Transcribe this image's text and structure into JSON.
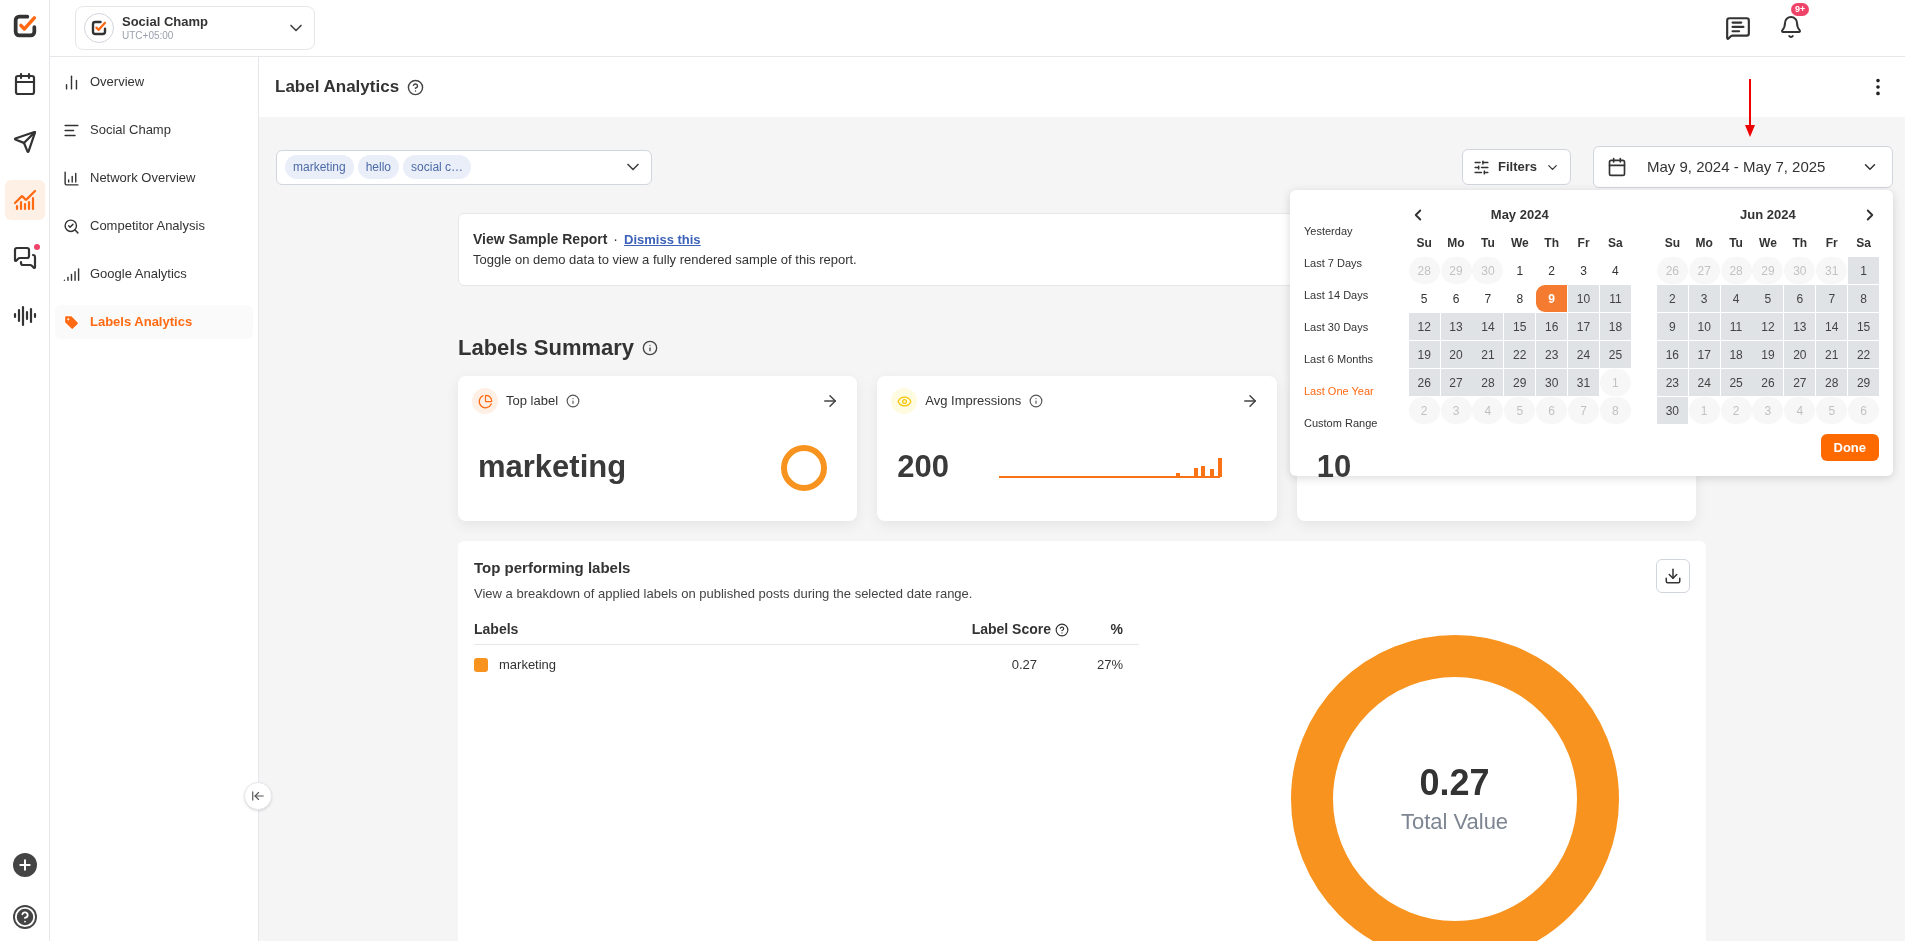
{
  "rail": {
    "items": [
      {
        "kind": "calendar",
        "selected": false,
        "dot": false
      },
      {
        "kind": "send",
        "selected": false,
        "dot": false
      },
      {
        "kind": "analytics",
        "selected": true,
        "dot": false
      },
      {
        "kind": "chat",
        "selected": false,
        "dot": true
      },
      {
        "kind": "audio",
        "selected": false,
        "dot": false
      }
    ]
  },
  "account": {
    "name": "Social Champ",
    "timezone": "UTC+05:00"
  },
  "notifications": {
    "badge": "9+"
  },
  "sidebar": {
    "items": [
      {
        "kind": "overview",
        "label": "Overview",
        "selected": false
      },
      {
        "kind": "social",
        "label": "Social Champ",
        "selected": false
      },
      {
        "kind": "network",
        "label": "Network Overview",
        "selected": false
      },
      {
        "kind": "competitor",
        "label": "Competitor Analysis",
        "selected": false
      },
      {
        "kind": "google",
        "label": "Google Analytics",
        "selected": false
      },
      {
        "kind": "labels",
        "label": "Labels Analytics",
        "selected": true
      }
    ]
  },
  "page": {
    "title": "Label Analytics"
  },
  "label_select": {
    "tags": [
      "marketing",
      "hello",
      "social c…"
    ]
  },
  "filters": {
    "label": "Filters"
  },
  "date_range": {
    "value": "May 9, 2024 - May 7, 2025"
  },
  "date_picker": {
    "presets": [
      {
        "label": "Yesterday",
        "selected": false
      },
      {
        "label": "Last 7 Days",
        "selected": false
      },
      {
        "label": "Last 14 Days",
        "selected": false
      },
      {
        "label": "Last 30 Days",
        "selected": false
      },
      {
        "label": "Last 6 Months",
        "selected": false
      },
      {
        "label": "Last One Year",
        "selected": true
      },
      {
        "label": "Custom Range",
        "selected": false
      }
    ],
    "months": [
      {
        "title": "May 2024",
        "weekdays": [
          "Su",
          "Mo",
          "Tu",
          "We",
          "Th",
          "Fr",
          "Sa"
        ],
        "weeks": [
          [
            {
              "day": "28",
              "kind": "outside"
            },
            {
              "day": "29",
              "kind": "outside"
            },
            {
              "day": "30",
              "kind": "outside"
            },
            {
              "day": "1",
              "kind": "plain"
            },
            {
              "day": "2",
              "kind": "plain"
            },
            {
              "day": "3",
              "kind": "plain"
            },
            {
              "day": "4",
              "kind": "plain"
            }
          ],
          [
            {
              "day": "5",
              "kind": "plain"
            },
            {
              "day": "6",
              "kind": "plain"
            },
            {
              "day": "7",
              "kind": "plain"
            },
            {
              "day": "8",
              "kind": "plain"
            },
            {
              "day": "9",
              "kind": "start"
            },
            {
              "day": "10",
              "kind": "range"
            },
            {
              "day": "11",
              "kind": "range"
            }
          ],
          [
            {
              "day": "12",
              "kind": "range"
            },
            {
              "day": "13",
              "kind": "range"
            },
            {
              "day": "14",
              "kind": "range"
            },
            {
              "day": "15",
              "kind": "range"
            },
            {
              "day": "16",
              "kind": "range"
            },
            {
              "day": "17",
              "kind": "range"
            },
            {
              "day": "18",
              "kind": "range"
            }
          ],
          [
            {
              "day": "19",
              "kind": "range"
            },
            {
              "day": "20",
              "kind": "range"
            },
            {
              "day": "21",
              "kind": "range"
            },
            {
              "day": "22",
              "kind": "range"
            },
            {
              "day": "23",
              "kind": "range"
            },
            {
              "day": "24",
              "kind": "range"
            },
            {
              "day": "25",
              "kind": "range"
            }
          ],
          [
            {
              "day": "26",
              "kind": "range"
            },
            {
              "day": "27",
              "kind": "range"
            },
            {
              "day": "28",
              "kind": "range"
            },
            {
              "day": "29",
              "kind": "range"
            },
            {
              "day": "30",
              "kind": "range"
            },
            {
              "day": "31",
              "kind": "range"
            },
            {
              "day": "1",
              "kind": "outside"
            }
          ],
          [
            {
              "day": "2",
              "kind": "outside"
            },
            {
              "day": "3",
              "kind": "outside"
            },
            {
              "day": "4",
              "kind": "outside"
            },
            {
              "day": "5",
              "kind": "outside"
            },
            {
              "day": "6",
              "kind": "outside"
            },
            {
              "day": "7",
              "kind": "outside"
            },
            {
              "day": "8",
              "kind": "outside"
            }
          ]
        ]
      },
      {
        "title": "Jun 2024",
        "weekdays": [
          "Su",
          "Mo",
          "Tu",
          "We",
          "Th",
          "Fr",
          "Sa"
        ],
        "weeks": [
          [
            {
              "day": "26",
              "kind": "outside"
            },
            {
              "day": "27",
              "kind": "outside"
            },
            {
              "day": "28",
              "kind": "outside"
            },
            {
              "day": "29",
              "kind": "outside"
            },
            {
              "day": "30",
              "kind": "outside"
            },
            {
              "day": "31",
              "kind": "outside"
            },
            {
              "day": "1",
              "kind": "range"
            }
          ],
          [
            {
              "day": "2",
              "kind": "range"
            },
            {
              "day": "3",
              "kind": "range"
            },
            {
              "day": "4",
              "kind": "range"
            },
            {
              "day": "5",
              "kind": "range"
            },
            {
              "day": "6",
              "kind": "range"
            },
            {
              "day": "7",
              "kind": "range"
            },
            {
              "day": "8",
              "kind": "range"
            }
          ],
          [
            {
              "day": "9",
              "kind": "range"
            },
            {
              "day": "10",
              "kind": "range"
            },
            {
              "day": "11",
              "kind": "range"
            },
            {
              "day": "12",
              "kind": "range"
            },
            {
              "day": "13",
              "kind": "range"
            },
            {
              "day": "14",
              "kind": "range"
            },
            {
              "day": "15",
              "kind": "range"
            }
          ],
          [
            {
              "day": "16",
              "kind": "range"
            },
            {
              "day": "17",
              "kind": "range"
            },
            {
              "day": "18",
              "kind": "range"
            },
            {
              "day": "19",
              "kind": "range"
            },
            {
              "day": "20",
              "kind": "range"
            },
            {
              "day": "21",
              "kind": "range"
            },
            {
              "day": "22",
              "kind": "range"
            }
          ],
          [
            {
              "day": "23",
              "kind": "range"
            },
            {
              "day": "24",
              "kind": "range"
            },
            {
              "day": "25",
              "kind": "range"
            },
            {
              "day": "26",
              "kind": "range"
            },
            {
              "day": "27",
              "kind": "range"
            },
            {
              "day": "28",
              "kind": "range"
            },
            {
              "day": "29",
              "kind": "range"
            }
          ],
          [
            {
              "day": "30",
              "kind": "range"
            },
            {
              "day": "1",
              "kind": "outside"
            },
            {
              "day": "2",
              "kind": "outside"
            },
            {
              "day": "3",
              "kind": "outside"
            },
            {
              "day": "4",
              "kind": "outside"
            },
            {
              "day": "5",
              "kind": "outside"
            },
            {
              "day": "6",
              "kind": "outside"
            }
          ]
        ]
      }
    ],
    "done": "Done"
  },
  "sample_report": {
    "title": "View Sample Report",
    "separator": "·",
    "link": "Dismiss this",
    "description": "Toggle on demo data to view a fully rendered sample of this report."
  },
  "summary": {
    "title": "Labels Summary",
    "cards": [
      {
        "kind": "ring",
        "title": "Top label",
        "value": "marketing"
      },
      {
        "kind": "sparkline",
        "title": "Avg Impressions",
        "value": "200"
      },
      {
        "kind": "line",
        "value": "10"
      }
    ]
  },
  "top_labels": {
    "title": "Top performing labels",
    "description": "View a breakdown of applied labels on published posts during the selected date range.",
    "columns": [
      "Labels",
      "Label Score",
      "%"
    ],
    "rows": [
      {
        "label": "marketing",
        "color": "#f7931e",
        "score": "0.27",
        "percent": "27%"
      }
    ],
    "total": {
      "value": "0.27",
      "caption": "Total Value"
    }
  }
}
